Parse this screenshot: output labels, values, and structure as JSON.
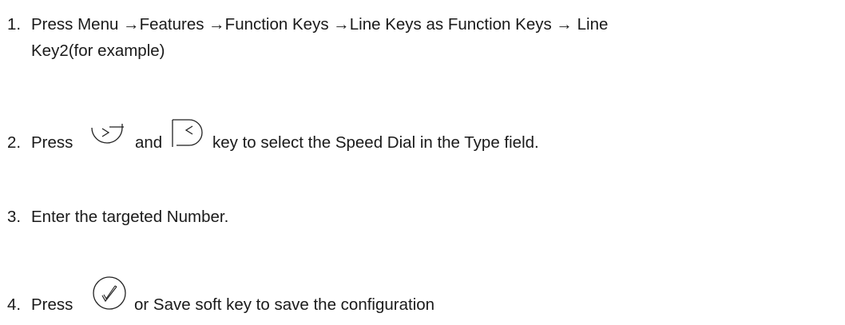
{
  "steps": [
    {
      "number": "1.",
      "line1": "Press Menu →Features →Function Keys →Line Keys as Function Keys →  Line",
      "line2": "Key2(for example)"
    },
    {
      "number": "2.",
      "press": "Press",
      "and": "and",
      "rest": "key to select the Speed Dial in the Type field.",
      "icons": [
        "right-arrow-key-icon",
        "left-arrow-key-icon"
      ]
    },
    {
      "number": "3.",
      "text": "Enter the targeted Number."
    },
    {
      "number": "4.",
      "press": "Press",
      "rest": "or Save soft key to save the  configuration",
      "icons": [
        "ok-key-icon"
      ]
    }
  ]
}
